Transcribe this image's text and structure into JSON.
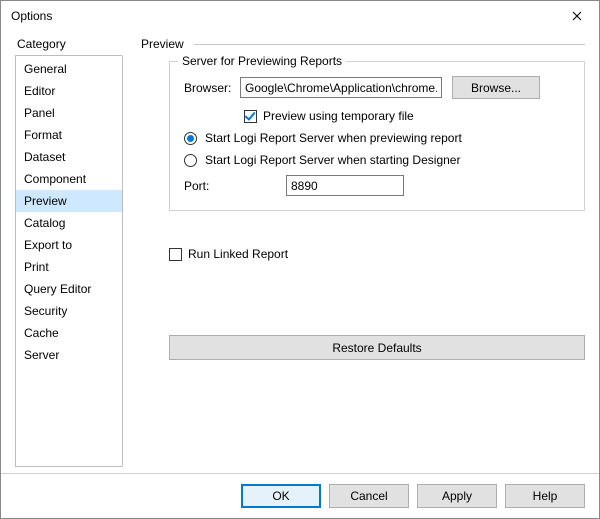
{
  "window": {
    "title": "Options"
  },
  "category": {
    "label": "Category",
    "items": [
      "General",
      "Editor",
      "Panel",
      "Format",
      "Dataset",
      "Component",
      "Preview",
      "Catalog",
      "Export to",
      "Print",
      "Query Editor",
      "Security",
      "Cache",
      "Server"
    ],
    "selected": "Preview"
  },
  "panel": {
    "heading": "Preview",
    "groupbox_title": "Server for Previewing Reports",
    "browser_label": "Browser:",
    "browser_value": "Google\\Chrome\\Application\\chrome.exe",
    "browse_button": "Browse...",
    "checkbox_preview_temp": "Preview using temporary file",
    "checkbox_preview_temp_checked": true,
    "radio_start_preview": "Start Logi Report Server when previewing report",
    "radio_start_designer": "Start Logi Report Server when starting Designer",
    "radio_selected": "preview",
    "port_label": "Port:",
    "port_value": "8890",
    "run_linked_label": "Run Linked Report",
    "run_linked_checked": false,
    "restore_defaults": "Restore Defaults"
  },
  "buttons": {
    "ok": "OK",
    "cancel": "Cancel",
    "apply": "Apply",
    "help": "Help"
  }
}
